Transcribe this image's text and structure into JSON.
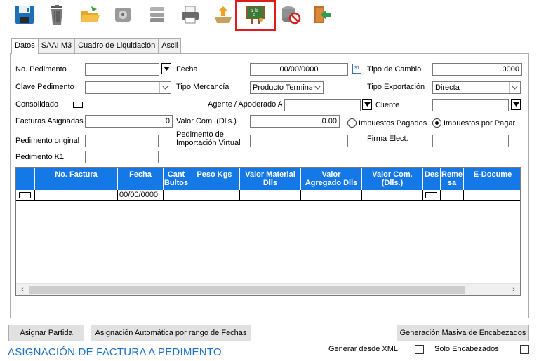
{
  "toolbar": {
    "buttons": [
      {
        "name": "save-icon"
      },
      {
        "name": "delete-bin-icon"
      },
      {
        "name": "open-folder-icon"
      },
      {
        "name": "disk-icon"
      },
      {
        "name": "database-icon"
      },
      {
        "name": "printer-icon"
      },
      {
        "name": "export-icon"
      },
      {
        "name": "assign-chalkboard-icon",
        "highlighted": true
      },
      {
        "name": "database-cancel-icon"
      },
      {
        "name": "exit-door-icon"
      }
    ],
    "highlight_color": "#e01b1b"
  },
  "tabs": [
    {
      "label": "Datos",
      "active": true
    },
    {
      "label": "SAAI M3",
      "active": false
    },
    {
      "label": "Cuadro de Liquidación",
      "active": false
    },
    {
      "label": "Ascii",
      "active": false
    }
  ],
  "form": {
    "no_pedimento_label": "No. Pedimento",
    "no_pedimento_value": "",
    "fecha_label": "Fecha",
    "fecha_value": "00/00/0000",
    "tipo_cambio_label": "Tipo de Cambio",
    "tipo_cambio_value": ".0000",
    "clave_pedimento_label": "Clave Pedimento",
    "clave_pedimento_value": "",
    "tipo_mercancia_label": "Tipo Mercancía",
    "tipo_mercancia_value": "Producto Termina",
    "tipo_exportacion_label": "Tipo Exportación",
    "tipo_exportacion_value": "Directa",
    "consolidado_label": "Consolidado",
    "agente_label": "Agente / Apoderado A",
    "agente_value": "",
    "cliente_label": "Cliente",
    "cliente_value": "",
    "facturas_label": "Facturas Asignadas",
    "facturas_value": "0",
    "valor_com_label": "Valor Com. (Dlls.)",
    "valor_com_value": "0.00",
    "impuestos_pagados_label": "Impuestos Pagados",
    "impuestos_por_pagar_label": "Impuestos por Pagar",
    "pedimento_original_label": "Pedimento original",
    "pedimento_original_value": "",
    "pedimento_virtual_label_1": "Pedimento de",
    "pedimento_virtual_label_2": "Importación Virtual",
    "pedimento_virtual_value": "",
    "firma_label": "Firma Elect.",
    "firma_value": "",
    "pedimento_k1_label": "Pedimento K1",
    "pedimento_k1_value": ""
  },
  "grid": {
    "header_color": "#1479e6",
    "columns": [
      {
        "l1": "",
        "l2": ""
      },
      {
        "l1": "No. Factura",
        "l2": ""
      },
      {
        "l1": "Fecha",
        "l2": ""
      },
      {
        "l1": "Cant",
        "l2": "Bultos"
      },
      {
        "l1": "Peso Kgs",
        "l2": ""
      },
      {
        "l1": "Valor Material",
        "l2": "Dlls"
      },
      {
        "l1": "Valor",
        "l2": "Agregado Dlls"
      },
      {
        "l1": "Valor Com.",
        "l2": "(Dlls.)"
      },
      {
        "l1": "Des",
        "l2": ""
      },
      {
        "l1": "Reme",
        "l2": "sa"
      },
      {
        "l1": "E-Docume",
        "l2": ""
      }
    ],
    "row": [
      "",
      "",
      "00/00/0000",
      "",
      "",
      "",
      "",
      "",
      "",
      "",
      ""
    ]
  },
  "buttons": {
    "asignar_partida": "Asignar Partida",
    "asignacion_automatica": "Asignación Automática por rango de Fechas",
    "generacion_masiva": "Generación Masiva de Encabezados"
  },
  "footer": {
    "title": "ASIGNACIÓN DE FACTURA A PEDIMENTO",
    "title_color": "#1e6fc7",
    "generar_xml_label": "Generar desde XML",
    "solo_encabezados_label": "Solo Encabezados"
  }
}
